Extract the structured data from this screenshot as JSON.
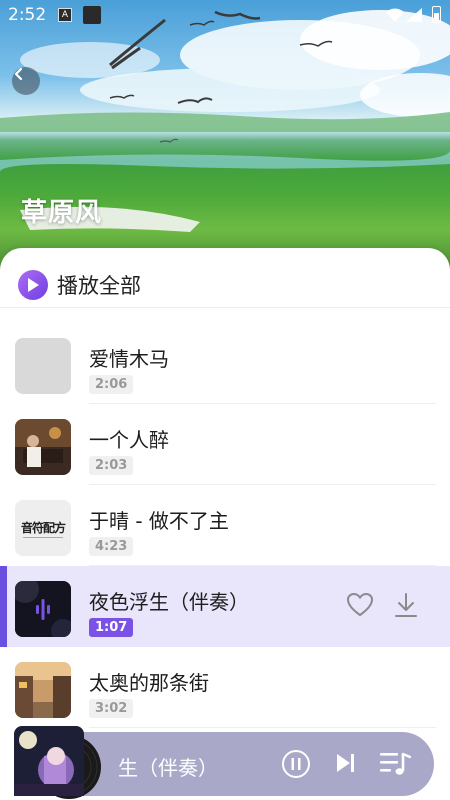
{
  "status_bar": {
    "time": "2:52",
    "icon_a": "A"
  },
  "hero": {
    "title": "草原风"
  },
  "play_all": {
    "label": "播放全部"
  },
  "songs": [
    {
      "title": "爱情木马",
      "duration": "2:06"
    },
    {
      "title": "一个人醉",
      "duration": "2:03"
    },
    {
      "title": "于晴 - 做不了主",
      "duration": "4:23",
      "cover_text": "音符配方"
    },
    {
      "title": "夜色浮生（伴奏）",
      "duration": "1:07",
      "playing": true
    },
    {
      "title": "太奥的那条街",
      "duration": "3:02"
    }
  ],
  "mini_player": {
    "title": "生（伴奏）"
  },
  "colors": {
    "accent": "#6b4fe0",
    "active_row": "#e9e5fb",
    "mini_bg": "#a9a8c8"
  }
}
